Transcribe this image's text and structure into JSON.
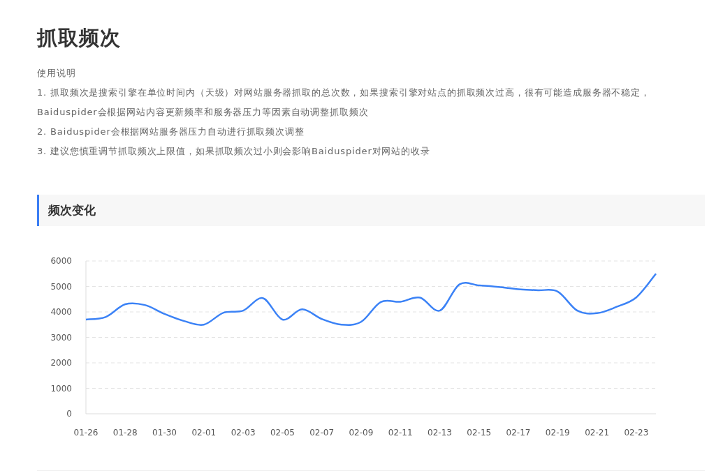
{
  "title": "抓取频次",
  "instructions": {
    "heading": "使用说明",
    "items": [
      "1. 抓取频次是搜索引擎在单位时间内（天级）对网站服务器抓取的总次数，如果搜索引擎对站点的抓取频次过高，很有可能造成服务器不稳定，Baiduspider会根据网站内容更新频率和服务器压力等因素自动调整抓取频次",
      "2. Baiduspider会根据网站服务器压力自动进行抓取频次调整",
      "3. 建议您慎重调节抓取频次上限值，如果抓取频次过小则会影响Baiduspider对网站的收录"
    ]
  },
  "section": {
    "title": "频次变化",
    "chart_data": {
      "type": "line",
      "grid": true,
      "categories": [
        "01-26",
        null,
        "01-28",
        null,
        "01-30",
        null,
        "02-01",
        null,
        "02-03",
        null,
        "02-05",
        null,
        "02-07",
        null,
        "02-09",
        null,
        "02-11",
        null,
        "02-13",
        null,
        "02-15",
        null,
        "02-17",
        null,
        "02-19",
        null,
        "02-21",
        null,
        "02-23",
        null
      ],
      "ylim": [
        0,
        6000
      ],
      "yticks": [
        0,
        1000,
        2000,
        3000,
        4000,
        5000,
        6000
      ],
      "series": [
        {
          "color": "#3b82f6",
          "values": [
            3700,
            3800,
            4300,
            4270,
            3920,
            3640,
            3500,
            3970,
            4050,
            4540,
            3700,
            4100,
            3720,
            3500,
            3610,
            4390,
            4400,
            4560,
            4050,
            5080,
            5040,
            4980,
            4890,
            4850,
            4800,
            4050,
            3950,
            4200,
            4570,
            5500
          ]
        }
      ]
    }
  }
}
